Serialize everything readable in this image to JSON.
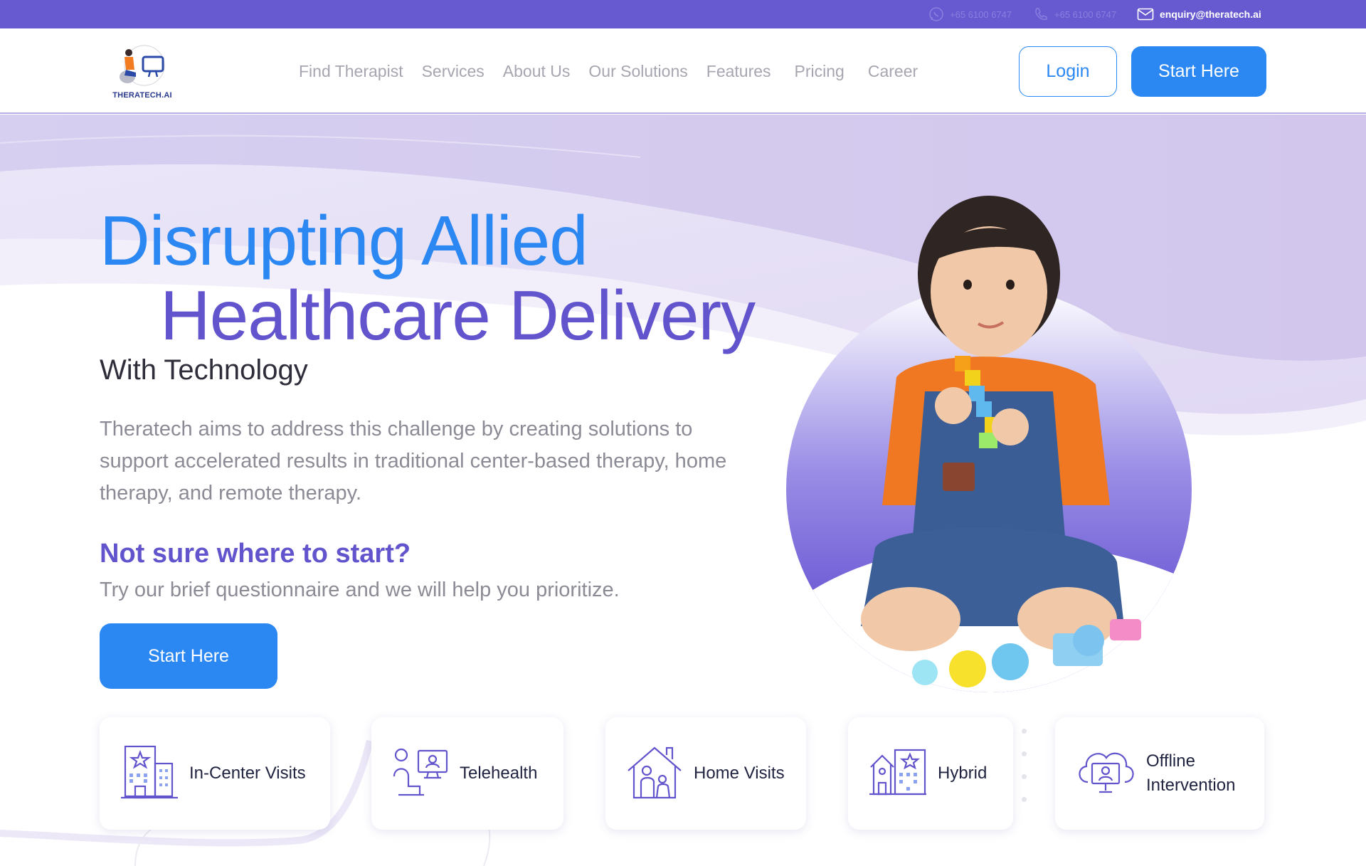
{
  "topbar": {
    "whatsapp": "+65 6100 6747",
    "phone": "+65 6100 6747",
    "email": "enquiry@theratech.ai"
  },
  "brand": {
    "name": "THERATECH.AI"
  },
  "nav": {
    "items": [
      {
        "label": "Find Therapist"
      },
      {
        "label": "Services"
      },
      {
        "label": "About Us"
      },
      {
        "label": "Our Solutions"
      },
      {
        "label": "Features"
      },
      {
        "label": "Pricing"
      },
      {
        "label": "Career"
      }
    ],
    "login_label": "Login",
    "start_label": "Start Here"
  },
  "hero": {
    "title_line1": "Disrupting Allied",
    "title_line2": "Healthcare Delivery",
    "subtitle": "With Technology",
    "description": "Theratech aims to address this challenge by creating solutions to support accelerated results in traditional center-based therapy, home therapy, and remote therapy.",
    "question": "Not sure where to start?",
    "prompt": "Try our brief questionnaire and we will help you prioritize.",
    "cta_label": "Start Here"
  },
  "services": [
    {
      "label": "In-Center Visits",
      "icon": "building-icon"
    },
    {
      "label": "Telehealth",
      "icon": "telehealth-icon"
    },
    {
      "label": "Home Visits",
      "icon": "home-visit-icon"
    },
    {
      "label": "Hybrid",
      "icon": "hybrid-icon"
    },
    {
      "label": "Offline Intervention",
      "icon": "cloud-icon"
    }
  ],
  "colors": {
    "topbar": "#6759cf",
    "primary_blue": "#2b87f2",
    "primary_purple": "#6254cc",
    "text_grey": "#8b8b95"
  }
}
